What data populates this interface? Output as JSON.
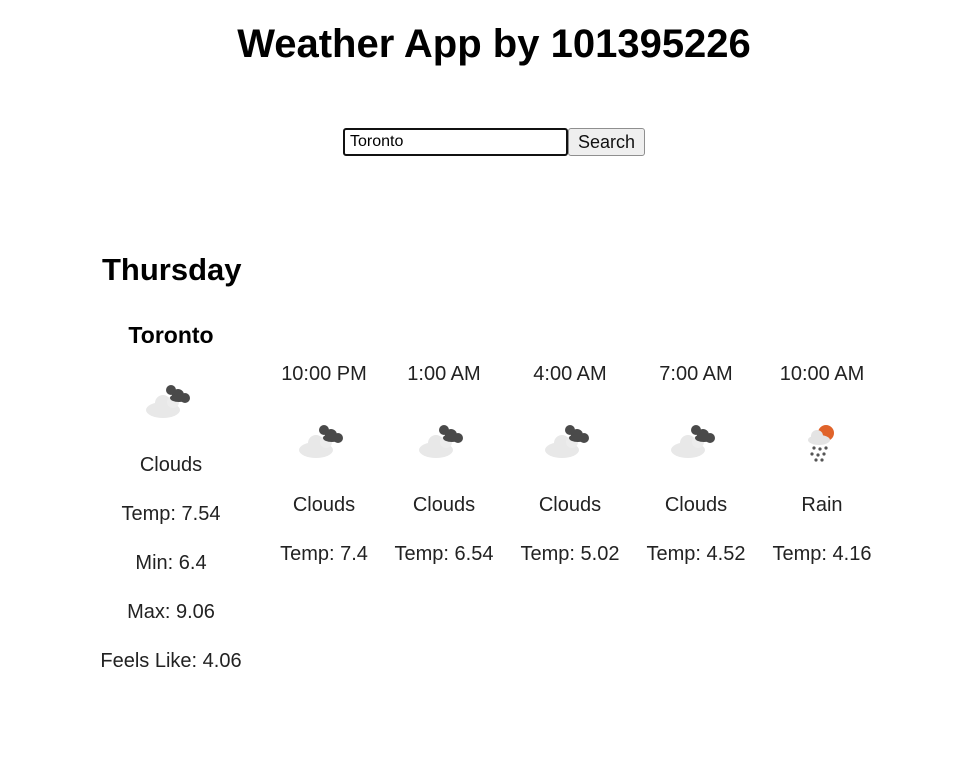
{
  "app": {
    "title": "Weather App by 101395226"
  },
  "search": {
    "value": "Toronto",
    "button_label": "Search"
  },
  "day": {
    "name": "Thursday"
  },
  "current": {
    "city": "Toronto",
    "icon": "clouds-icon",
    "description": "Clouds",
    "temp": "Temp: 7.54",
    "min": "Min: 6.4",
    "max": "Max: 9.06",
    "feels_like": "Feels Like: 4.06"
  },
  "forecast": [
    {
      "time": "10:00 PM",
      "icon": "clouds-icon",
      "description": "Clouds",
      "temp": "Temp: 7.4"
    },
    {
      "time": "1:00 AM",
      "icon": "clouds-icon",
      "description": "Clouds",
      "temp": "Temp: 6.54"
    },
    {
      "time": "4:00 AM",
      "icon": "clouds-icon",
      "description": "Clouds",
      "temp": "Temp: 5.02"
    },
    {
      "time": "7:00 AM",
      "icon": "clouds-icon",
      "description": "Clouds",
      "temp": "Temp: 4.52"
    },
    {
      "time": "10:00 AM",
      "icon": "rain-icon",
      "description": "Rain",
      "temp": "Temp: 4.16"
    }
  ],
  "colors": {
    "cloud_light": "#e8e8e8",
    "cloud_dark": "#4a4a4a",
    "sun": "#e0632a",
    "rain": "#555555"
  }
}
